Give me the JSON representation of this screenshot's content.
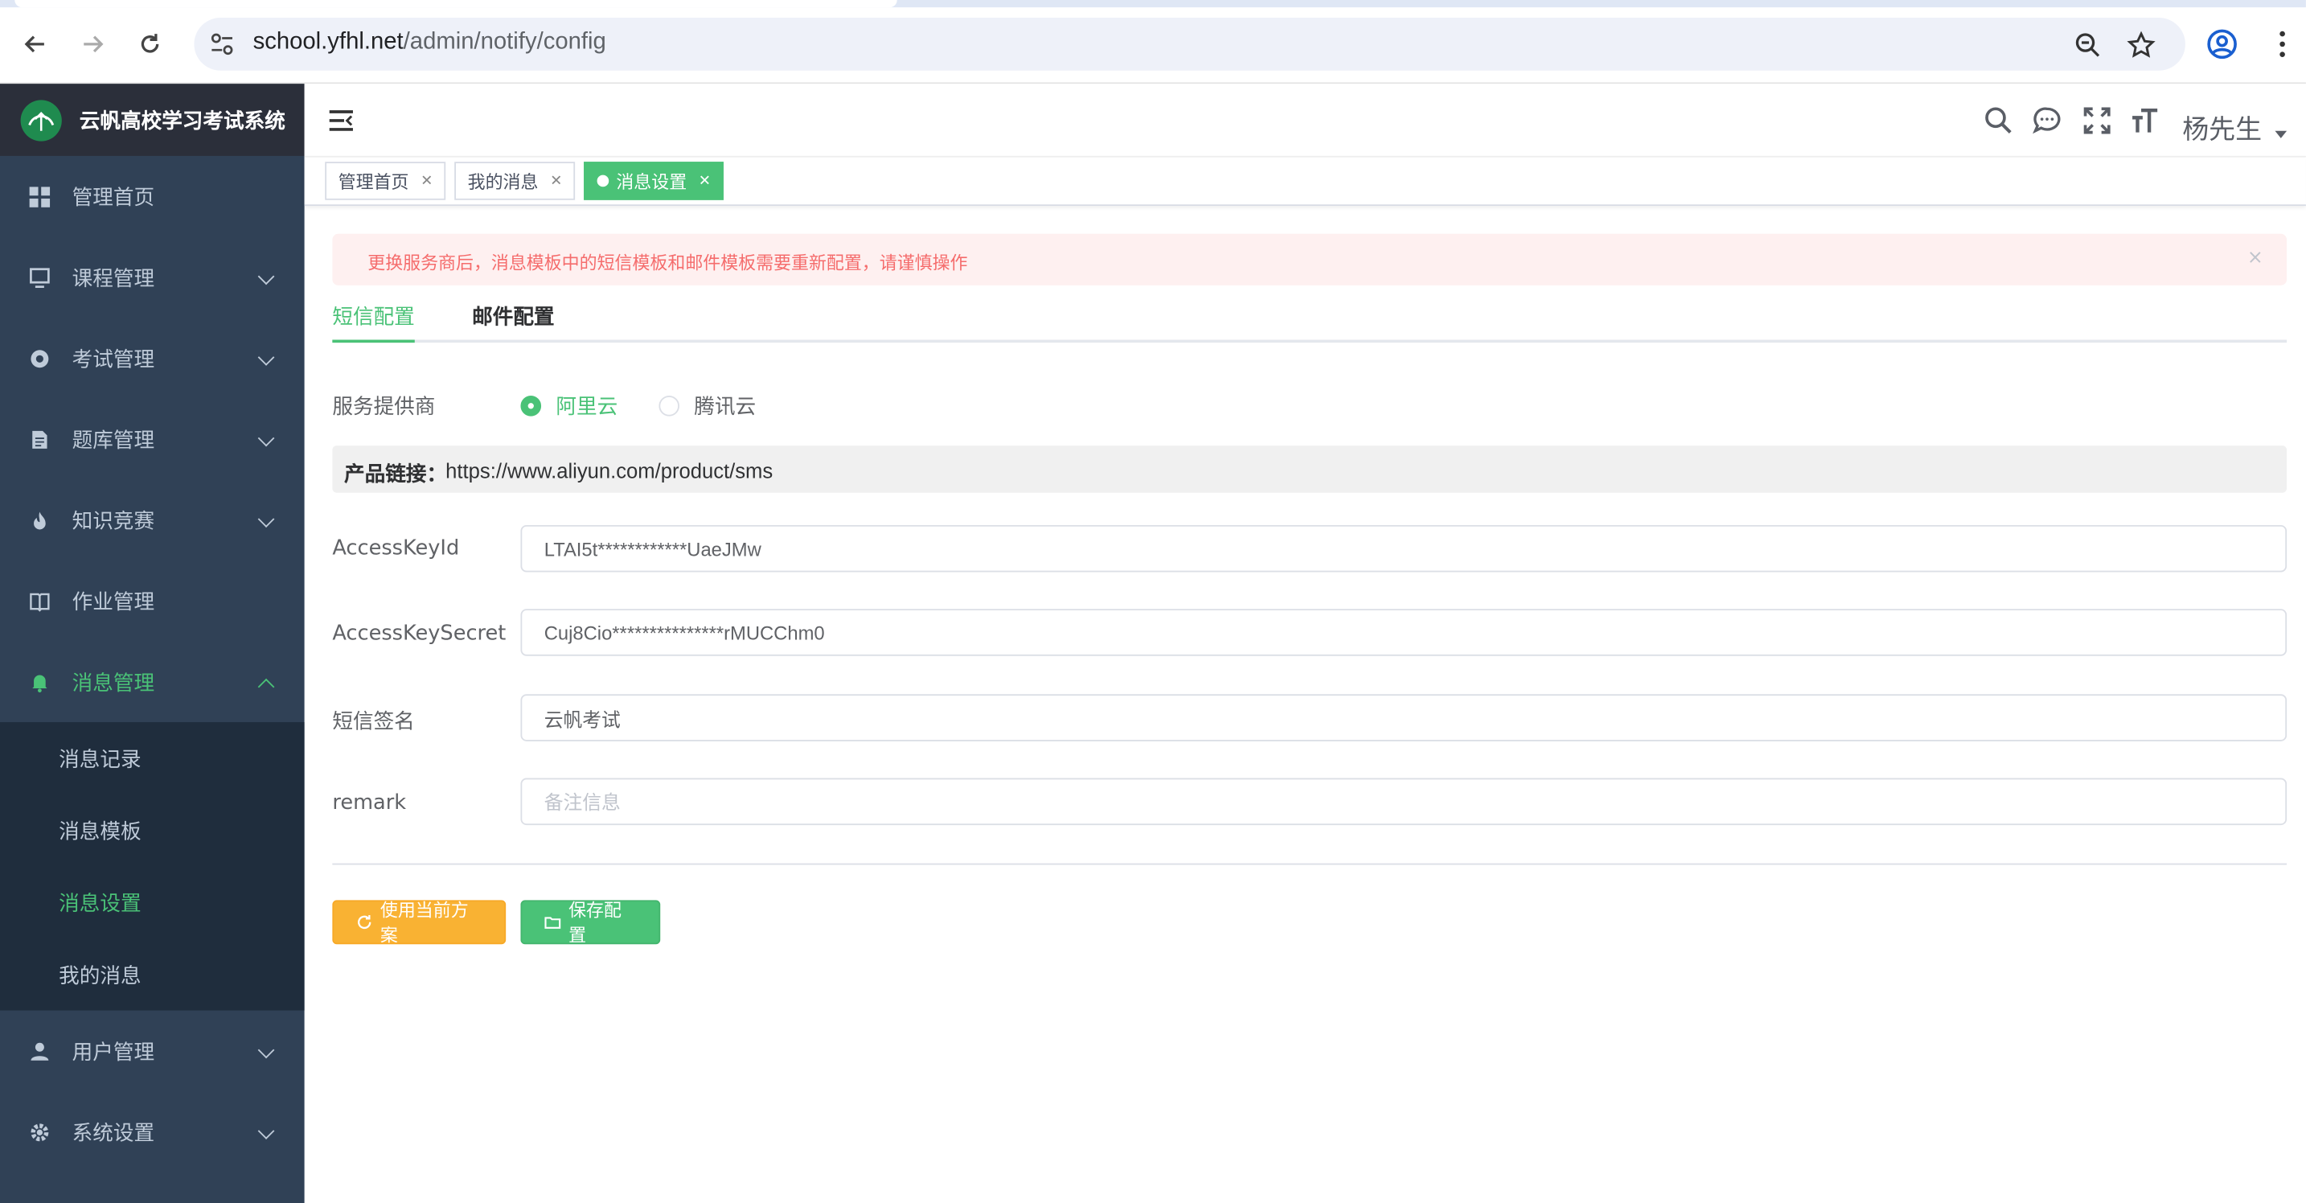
{
  "browser": {
    "url_host": "school.yfhl.net",
    "url_path": "/admin/notify/config"
  },
  "app": {
    "title": "云帆高校学习考试系统",
    "username": "杨先生"
  },
  "sidebar": {
    "items": [
      {
        "label": "管理首页",
        "icon": "dashboard-icon"
      },
      {
        "label": "课程管理",
        "icon": "monitor-icon"
      },
      {
        "label": "考试管理",
        "icon": "aperture-icon"
      },
      {
        "label": "题库管理",
        "icon": "document-icon"
      },
      {
        "label": "知识竞赛",
        "icon": "fire-icon"
      },
      {
        "label": "作业管理",
        "icon": "book-icon"
      },
      {
        "label": "消息管理",
        "icon": "bell-icon"
      },
      {
        "label": "用户管理",
        "icon": "user-icon"
      },
      {
        "label": "系统设置",
        "icon": "gear-icon"
      }
    ],
    "submenu": [
      {
        "label": "消息记录"
      },
      {
        "label": "消息模板"
      },
      {
        "label": "消息设置"
      },
      {
        "label": "我的消息"
      }
    ]
  },
  "tags": [
    {
      "label": "管理首页"
    },
    {
      "label": "我的消息"
    },
    {
      "label": "消息设置"
    }
  ],
  "alert": {
    "text": "更换服务商后，消息模板中的短信模板和邮件模板需要重新配置，请谨慎操作",
    "close": "×"
  },
  "tabs": [
    {
      "label": "短信配置"
    },
    {
      "label": "邮件配置"
    }
  ],
  "form": {
    "provider_label": "服务提供商",
    "providers": [
      {
        "label": "阿里云",
        "checked": true
      },
      {
        "label": "腾讯云",
        "checked": false
      }
    ],
    "product_link_label": "产品链接：",
    "product_link_url": "https://www.aliyun.com/product/sms",
    "fields": [
      {
        "label": "AccessKeyId",
        "value": "LTAI5t************UaeJMw",
        "placeholder": ""
      },
      {
        "label": "AccessKeySecret",
        "value": "Cuj8Cio***************rMUCChm0",
        "placeholder": ""
      },
      {
        "label": "短信签名",
        "value": "云帆考试",
        "placeholder": ""
      },
      {
        "label": "remark",
        "value": "",
        "placeholder": "备注信息"
      }
    ]
  },
  "buttons": {
    "use_current": "使用当前方案",
    "save": "保存配置"
  },
  "colors": {
    "accent": "#4ac277",
    "sidebar_bg": "#304156",
    "warning": "#f9b233",
    "danger_text": "#f56c6c"
  }
}
